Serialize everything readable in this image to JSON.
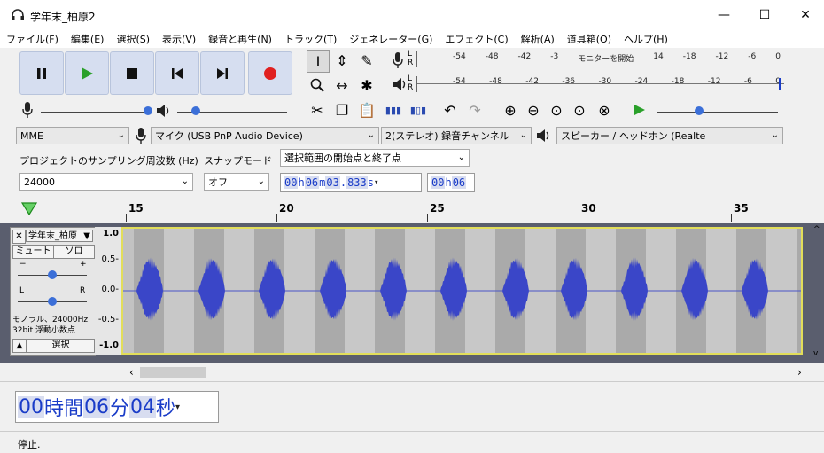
{
  "window": {
    "title": "学年末_柏原2",
    "minimize": "—",
    "maximize": "☐",
    "close": "✕"
  },
  "menu": [
    "ファイル(F)",
    "編集(E)",
    "選択(S)",
    "表示(V)",
    "録音と再生(N)",
    "トラック(T)",
    "ジェネレーター(G)",
    "エフェクト(C)",
    "解析(A)",
    "道具箱(O)",
    "ヘルプ(H)"
  ],
  "meters": {
    "record_ticks": [
      "-54",
      "-48",
      "-42",
      "-3",
      "モニターを開始",
      "14",
      "-18",
      "-12",
      "-6",
      "0"
    ],
    "play_ticks": [
      "-54",
      "-48",
      "-42",
      "-36",
      "-30",
      "-24",
      "-18",
      "-12",
      "-6",
      "0"
    ],
    "L": "L",
    "R": "R"
  },
  "device": {
    "host": "MME",
    "mic": "マイク (USB PnP Audio Device)",
    "channels": "2(ステレオ) 録音チャンネル",
    "speaker": "スピーカー / ヘッドホン (Realte"
  },
  "project": {
    "rate_label": "プロジェクトのサンプリング周波数 (Hz)",
    "rate_value": "24000",
    "snap_label": "スナップモード",
    "snap_value": "オフ",
    "selection_mode": "選択範囲の開始点と終了点",
    "sel_start_parts": [
      "00",
      "h",
      "06",
      "m",
      "03",
      ".",
      "833",
      "s"
    ],
    "sel_end_parts": [
      "00",
      "h",
      "06"
    ]
  },
  "ruler": {
    "labels": [
      "15",
      "20",
      "25",
      "30",
      "35"
    ]
  },
  "track": {
    "name": "学年末_柏原",
    "mute": "ミュート",
    "solo": "ソロ",
    "gain_minus": "−",
    "gain_plus": "+",
    "pan_L": "L",
    "pan_R": "R",
    "info1": "モノラル、24000Hz",
    "info2": "32bit 浮動小数点",
    "select": "選択",
    "scale": [
      "1.0",
      "0.5-",
      "0.0-",
      "-0.5-",
      "-1.0"
    ]
  },
  "time": {
    "parts": [
      "00",
      "時間",
      "06",
      "分",
      "04",
      "秒"
    ]
  },
  "status": "停止."
}
